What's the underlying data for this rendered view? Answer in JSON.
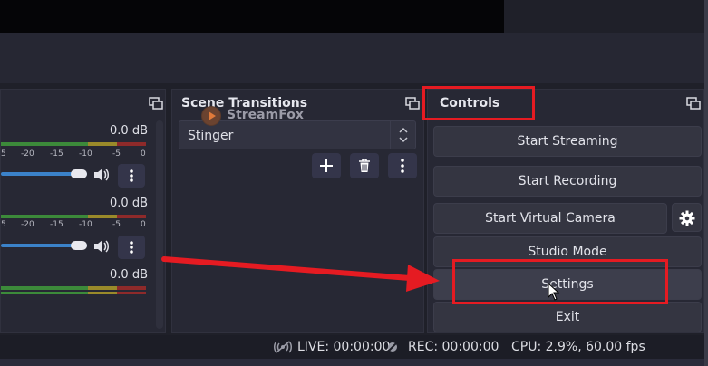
{
  "mixer": {
    "tracks": [
      {
        "db": "0.0 dB"
      },
      {
        "db": "0.0 dB"
      },
      {
        "db": "0.0 dB"
      }
    ],
    "tick_labels": [
      "5",
      "-20",
      "-15",
      "-10",
      "-5",
      "0"
    ]
  },
  "transitions": {
    "title": "Scene Transitions",
    "selected": "Stinger"
  },
  "watermark": {
    "text": "StreamFox"
  },
  "controls": {
    "title": "Controls",
    "start_streaming": "Start Streaming",
    "start_recording": "Start Recording",
    "start_virtual_camera": "Start Virtual Camera",
    "studio_mode": "Studio Mode",
    "settings": "Settings",
    "exit": "Exit"
  },
  "status": {
    "live": "LIVE: 00:00:00",
    "rec": "REC: 00:00:00",
    "cpu": "CPU: 2.9%, 60.00 fps"
  },
  "colors": {
    "highlight": "#e51b22",
    "accent": "#3b82c9"
  }
}
